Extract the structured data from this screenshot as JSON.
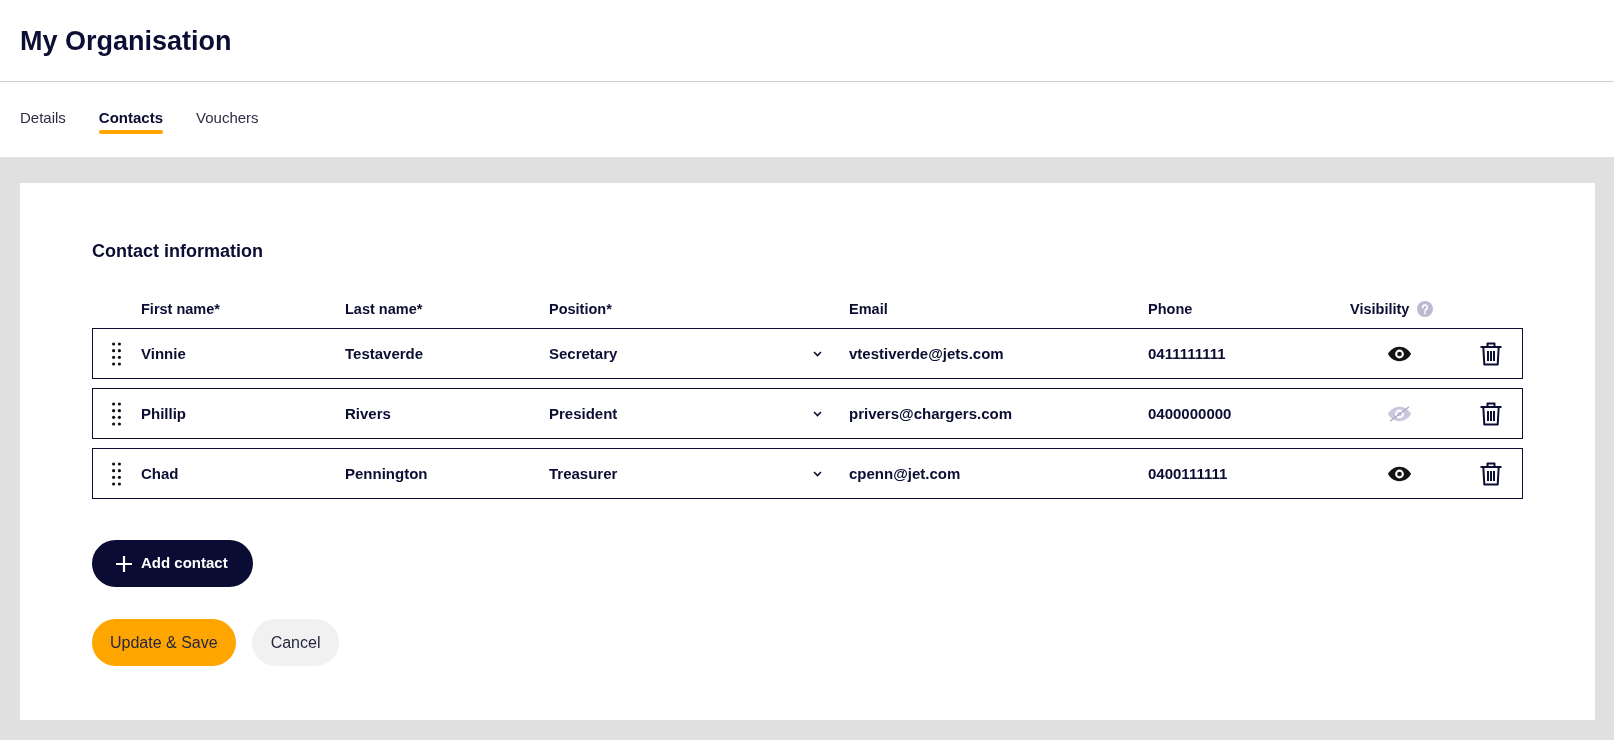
{
  "header": {
    "title": "My Organisation"
  },
  "tabs": [
    {
      "label": "Details",
      "selected": false
    },
    {
      "label": "Contacts",
      "selected": true
    },
    {
      "label": "Vouchers",
      "selected": false
    }
  ],
  "contacts": {
    "title": "Contact information",
    "columns": [
      {
        "label": "First name*",
        "help": false
      },
      {
        "label": "Last name*",
        "help": false
      },
      {
        "label": "Position*",
        "help": false
      },
      {
        "label": "Email",
        "help": false
      },
      {
        "label": "Phone",
        "help": false
      },
      {
        "label": "Visibility",
        "help": true
      }
    ],
    "rows": [
      {
        "first_name": "Vinnie",
        "last_name": "Testaverde",
        "position": "Secretary",
        "email": "vtestiverde@jets.com",
        "phone": "0411111111",
        "visible": true
      },
      {
        "first_name": "Phillip",
        "last_name": "Rivers",
        "position": "President",
        "email": "privers@chargers.com",
        "phone": "0400000000",
        "visible": false
      },
      {
        "first_name": "Chad",
        "last_name": "Pennington",
        "position": "Treasurer",
        "email": "cpenn@jet.com",
        "phone": "0400111111",
        "visible": true
      }
    ],
    "add_button": {
      "label": "Add contact"
    }
  },
  "actions": [
    {
      "label": "Update & Save",
      "kind": "primary"
    },
    {
      "label": "Cancel",
      "kind": "secondary"
    }
  ]
}
